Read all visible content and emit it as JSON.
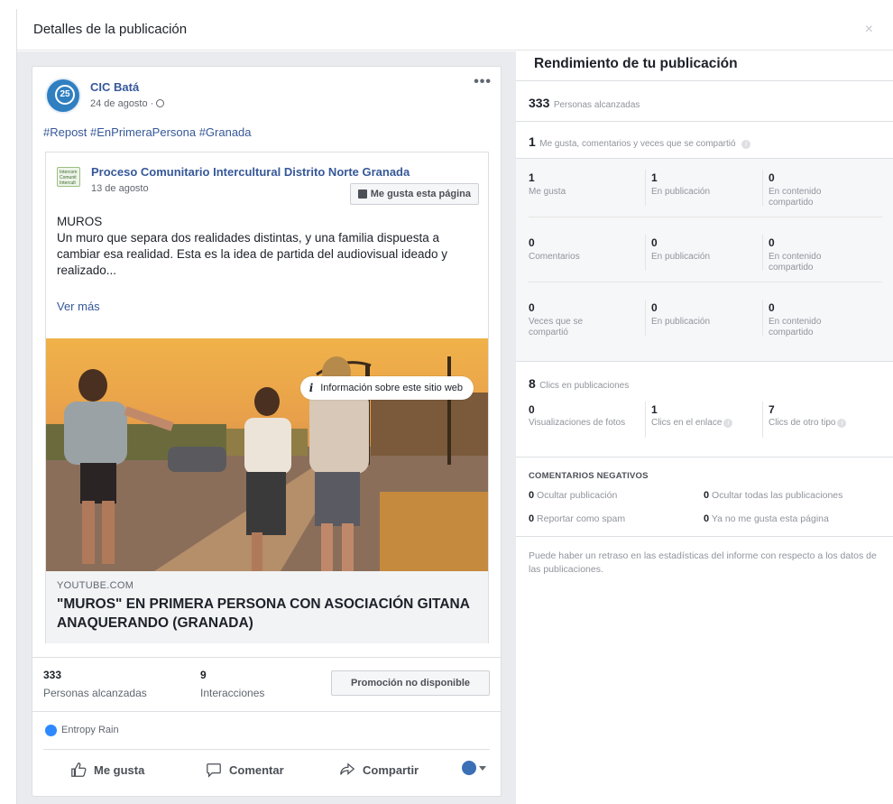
{
  "dialog": {
    "title": "Detalles de la publicación",
    "close": "×"
  },
  "post": {
    "page_name": "CIC Batá",
    "date": "24 de agosto ·",
    "avatar_text": "25",
    "more": "•••",
    "hashtags": "#Repost #EnPrimeraPersona #Granada",
    "shared": {
      "logo_text": "Intercom Comunit Intercult",
      "page_name": "Proceso Comunitario Intercultural Distrito Norte Granada",
      "date": "13 de agosto",
      "like_page_label": "Me gusta esta página",
      "text_line1": "MUROS",
      "text_body": "Un muro que separa dos realidades distintas, y una familia dispuesta a cambiar esa realidad. Esta es la idea de partida del audiovisual ideado y realizado...",
      "see_more": "Ver más",
      "info_pill": "Información sobre este sitio web",
      "link_domain": "YOUTUBE.COM",
      "link_title": "\"MUROS\" EN PRIMERA PERSONA CON ASOCIACIÓN GITANA ANAQUERANDO (GRANADA)"
    },
    "stats": {
      "reach_value": "333",
      "reach_label": "Personas alcanzadas",
      "interactions_value": "9",
      "interactions_label": "Interacciones",
      "promo_label": "Promoción no disponible"
    },
    "reactor": "Entropy Rain",
    "actions": {
      "like": "Me gusta",
      "comment": "Comentar",
      "share": "Compartir"
    }
  },
  "performance": {
    "title": "Rendimiento de tu publicación",
    "reach_value": "333",
    "reach_label": "Personas alcanzadas",
    "engagement_value": "1",
    "engagement_label": "Me gusta, comentarios y veces que se compartió",
    "grid": [
      [
        {
          "v": "1",
          "l": "Me gusta"
        },
        {
          "v": "1",
          "l": "En publicación"
        },
        {
          "v": "0",
          "l": "En contenido compartido"
        }
      ],
      [
        {
          "v": "0",
          "l": "Comentarios"
        },
        {
          "v": "0",
          "l": "En publicación"
        },
        {
          "v": "0",
          "l": "En contenido compartido"
        }
      ],
      [
        {
          "v": "0",
          "l": "Veces que se compartió"
        },
        {
          "v": "0",
          "l": "En publicación"
        },
        {
          "v": "0",
          "l": "En contenido compartido"
        }
      ]
    ],
    "clicks_value": "8",
    "clicks_label": "Clics en publicaciones",
    "clicks": [
      {
        "v": "0",
        "l": "Visualizaciones de fotos"
      },
      {
        "v": "1",
        "l": "Clics en el enlace"
      },
      {
        "v": "7",
        "l": "Clics de otro tipo"
      }
    ],
    "negative_title": "COMENTARIOS NEGATIVOS",
    "negative": [
      {
        "v": "0",
        "l": "Ocultar publicación"
      },
      {
        "v": "0",
        "l": "Ocultar todas las publicaciones"
      },
      {
        "v": "0",
        "l": "Reportar como spam"
      },
      {
        "v": "0",
        "l": "Ya no me gusta esta página"
      }
    ],
    "footnote": "Puede haber un retraso en las estadísticas del informe con respecto a los datos de las publicaciones.",
    "info_glyph": "i"
  },
  "colors": {
    "link": "#365899",
    "accent": "#2e89ff",
    "panel_bg": "#e9ebee"
  }
}
